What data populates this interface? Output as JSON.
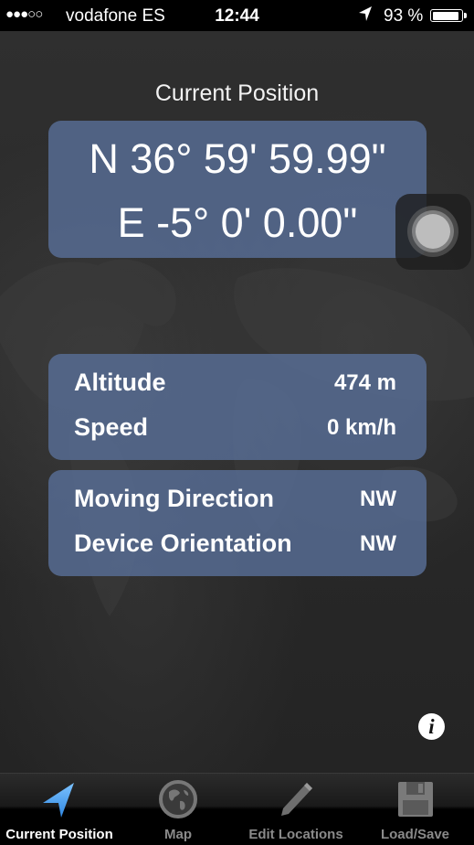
{
  "status_bar": {
    "signal": "●●●○○",
    "carrier": "vodafone ES",
    "time": "12:44",
    "location_icon": "location-arrow-icon",
    "battery_percent_label": "93 %",
    "battery_level": 0.93
  },
  "header": {
    "title": "Current Position"
  },
  "coordinates": {
    "latitude": "N 36° 59' 59.99\"",
    "longitude": "E -5° 0' 0.00\""
  },
  "motion": {
    "altitude_label": "Altitude",
    "altitude_value": "474 m",
    "speed_label": "Speed",
    "speed_value": "0 km/h"
  },
  "direction": {
    "moving_direction_label": "Moving Direction",
    "moving_direction_value": "NW",
    "device_orientation_label": "Device Orientation",
    "device_orientation_value": "NW"
  },
  "info_button": {
    "glyph": "i",
    "icon": "info-icon"
  },
  "tab_bar": {
    "tabs": [
      {
        "label": "Current Position",
        "icon": "navigation-arrow-icon",
        "active": true
      },
      {
        "label": "Map",
        "icon": "globe-icon",
        "active": false
      },
      {
        "label": "Edit Locations",
        "icon": "pencil-icon",
        "active": false
      },
      {
        "label": "Load/Save",
        "icon": "floppy-disk-icon",
        "active": false
      }
    ]
  },
  "colors": {
    "card_background": "#586e96",
    "active_tab_icon": "#4aa3f0",
    "inactive_tab": "#8a8a8a"
  }
}
